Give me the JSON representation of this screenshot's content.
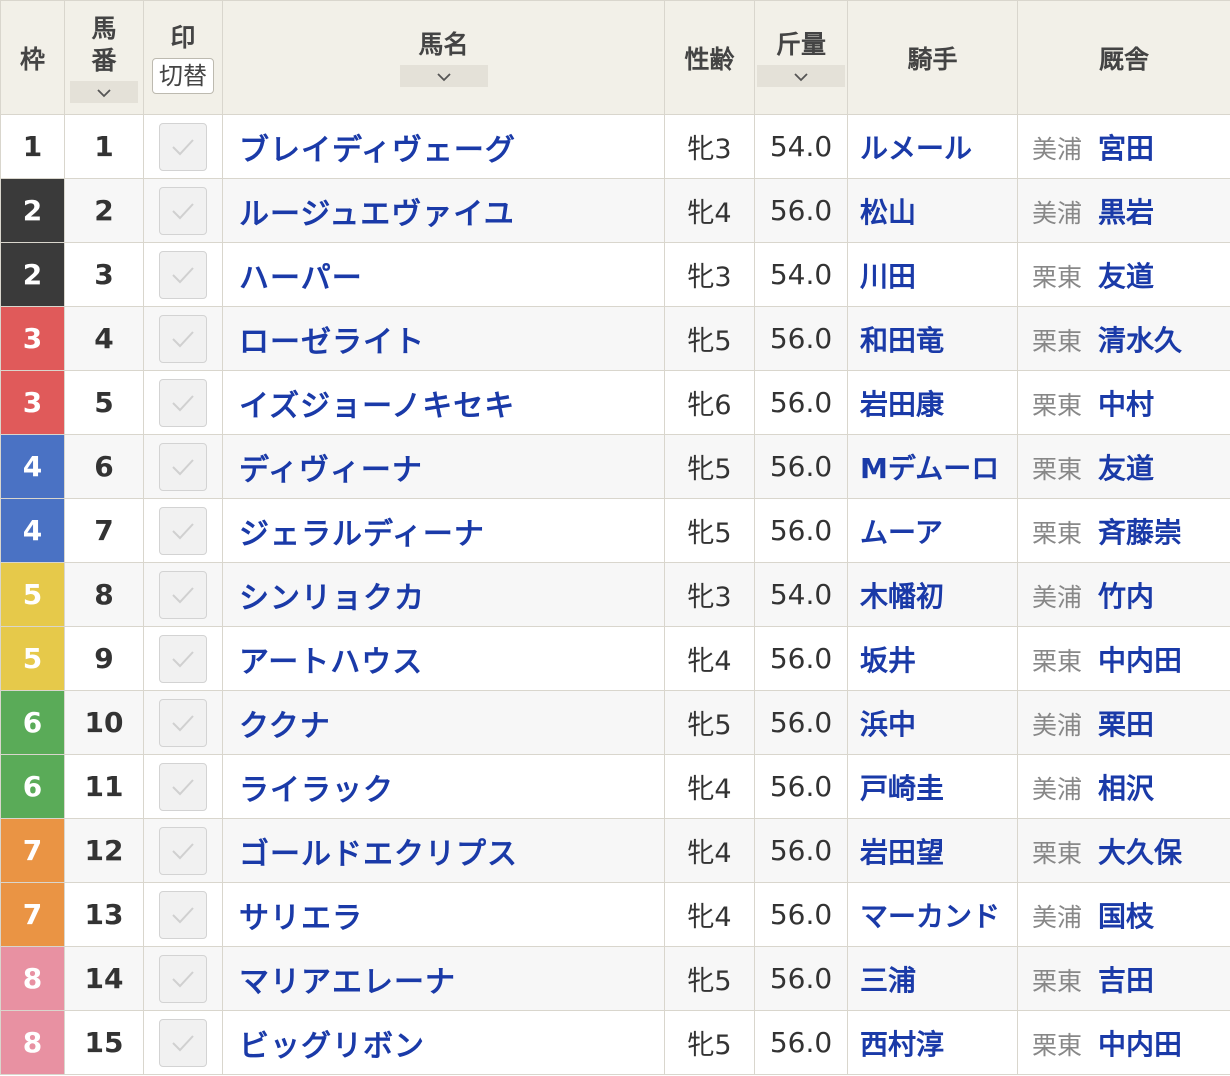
{
  "header": {
    "waku": "枠",
    "umaban_top": "馬",
    "umaban_bottom": "番",
    "mark": "印",
    "mark_switch": "切替",
    "name": "馬名",
    "sex_age": "性齢",
    "weight": "斤量",
    "jockey": "騎手",
    "stable": "厩舎"
  },
  "waku_colors": {
    "1": {
      "bg": "#ffffff",
      "fg": "#333333"
    },
    "2": {
      "bg": "#3a3a3a",
      "fg": "#ffffff"
    },
    "3": {
      "bg": "#e05a5a",
      "fg": "#ffffff"
    },
    "4": {
      "bg": "#4a72c4",
      "fg": "#ffffff"
    },
    "5": {
      "bg": "#e6c94a",
      "fg": "#ffffff"
    },
    "6": {
      "bg": "#5aab58",
      "fg": "#ffffff"
    },
    "7": {
      "bg": "#ea9444",
      "fg": "#ffffff"
    },
    "8": {
      "bg": "#e891a2",
      "fg": "#ffffff"
    }
  },
  "rows": [
    {
      "waku": "1",
      "umaban": "1",
      "name": "ブレイディヴェーグ",
      "sex_age": "牝3",
      "weight": "54.0",
      "jockey": "ルメール",
      "region": "美浦",
      "trainer": "宮田"
    },
    {
      "waku": "2",
      "umaban": "2",
      "name": "ルージュエヴァイユ",
      "sex_age": "牝4",
      "weight": "56.0",
      "jockey": "松山",
      "region": "美浦",
      "trainer": "黒岩"
    },
    {
      "waku": "2",
      "umaban": "3",
      "name": "ハーパー",
      "sex_age": "牝3",
      "weight": "54.0",
      "jockey": "川田",
      "region": "栗東",
      "trainer": "友道"
    },
    {
      "waku": "3",
      "umaban": "4",
      "name": "ローゼライト",
      "sex_age": "牝5",
      "weight": "56.0",
      "jockey": "和田竜",
      "region": "栗東",
      "trainer": "清水久"
    },
    {
      "waku": "3",
      "umaban": "5",
      "name": "イズジョーノキセキ",
      "sex_age": "牝6",
      "weight": "56.0",
      "jockey": "岩田康",
      "region": "栗東",
      "trainer": "中村"
    },
    {
      "waku": "4",
      "umaban": "6",
      "name": "ディヴィーナ",
      "sex_age": "牝5",
      "weight": "56.0",
      "jockey": "Mデムーロ",
      "region": "栗東",
      "trainer": "友道"
    },
    {
      "waku": "4",
      "umaban": "7",
      "name": "ジェラルディーナ",
      "sex_age": "牝5",
      "weight": "56.0",
      "jockey": "ムーア",
      "region": "栗東",
      "trainer": "斉藤崇"
    },
    {
      "waku": "5",
      "umaban": "8",
      "name": "シンリョクカ",
      "sex_age": "牝3",
      "weight": "54.0",
      "jockey": "木幡初",
      "region": "美浦",
      "trainer": "竹内"
    },
    {
      "waku": "5",
      "umaban": "9",
      "name": "アートハウス",
      "sex_age": "牝4",
      "weight": "56.0",
      "jockey": "坂井",
      "region": "栗東",
      "trainer": "中内田"
    },
    {
      "waku": "6",
      "umaban": "10",
      "name": "ククナ",
      "sex_age": "牝5",
      "weight": "56.0",
      "jockey": "浜中",
      "region": "美浦",
      "trainer": "栗田"
    },
    {
      "waku": "6",
      "umaban": "11",
      "name": "ライラック",
      "sex_age": "牝4",
      "weight": "56.0",
      "jockey": "戸崎圭",
      "region": "美浦",
      "trainer": "相沢"
    },
    {
      "waku": "7",
      "umaban": "12",
      "name": "ゴールドエクリプス",
      "sex_age": "牝4",
      "weight": "56.0",
      "jockey": "岩田望",
      "region": "栗東",
      "trainer": "大久保"
    },
    {
      "waku": "7",
      "umaban": "13",
      "name": "サリエラ",
      "sex_age": "牝4",
      "weight": "56.0",
      "jockey": "マーカンド",
      "region": "美浦",
      "trainer": "国枝"
    },
    {
      "waku": "8",
      "umaban": "14",
      "name": "マリアエレーナ",
      "sex_age": "牝5",
      "weight": "56.0",
      "jockey": "三浦",
      "region": "栗東",
      "trainer": "吉田"
    },
    {
      "waku": "8",
      "umaban": "15",
      "name": "ビッグリボン",
      "sex_age": "牝5",
      "weight": "56.0",
      "jockey": "西村淳",
      "region": "栗東",
      "trainer": "中内田"
    }
  ]
}
